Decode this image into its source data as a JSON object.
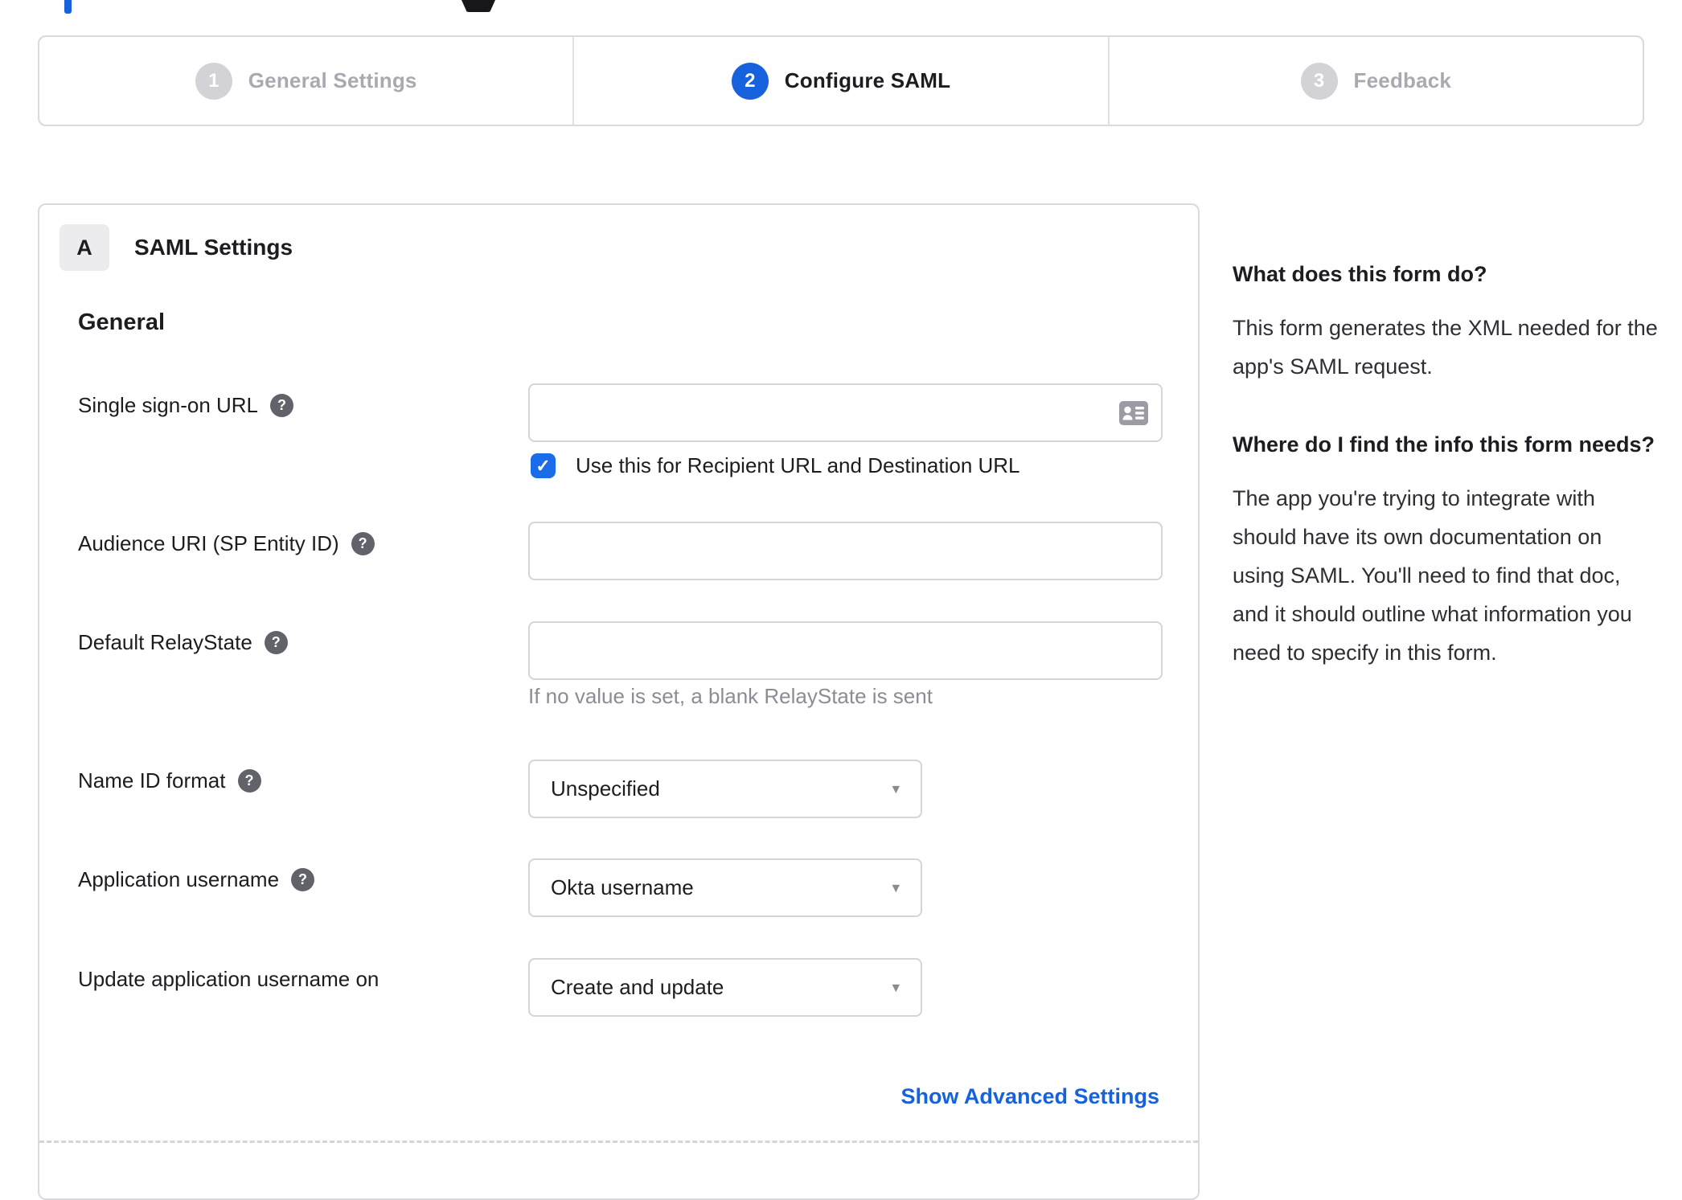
{
  "stepper": {
    "steps": [
      {
        "number": "1",
        "label": "General Settings",
        "state": "inactive"
      },
      {
        "number": "2",
        "label": "Configure SAML",
        "state": "active"
      },
      {
        "number": "3",
        "label": "Feedback",
        "state": "inactive"
      }
    ]
  },
  "panel": {
    "section_badge": "A",
    "section_title": "SAML Settings",
    "group_title": "General",
    "fields": {
      "sso_url": {
        "label": "Single sign-on URL",
        "value": ""
      },
      "sso_checkbox": {
        "label": "Use this for Recipient URL and Destination URL",
        "checked": true
      },
      "audience_uri": {
        "label": "Audience URI (SP Entity ID)",
        "value": ""
      },
      "default_relaystate": {
        "label": "Default RelayState",
        "value": "",
        "hint": "If no value is set, a blank RelayState is sent"
      },
      "name_id_format": {
        "label": "Name ID format",
        "value": "Unspecified"
      },
      "app_username": {
        "label": "Application username",
        "value": "Okta username"
      },
      "update_app_username": {
        "label": "Update application username on",
        "value": "Create and update"
      }
    },
    "advanced_link": "Show Advanced Settings"
  },
  "sidebar": {
    "sections": [
      {
        "heading": "What does this form do?",
        "body": "This form generates the XML needed for the app's SAML request."
      },
      {
        "heading": "Where do I find the info this form needs?",
        "body": "The app you're trying to integrate with should have its own documentation on using SAML. You'll need to find that doc, and it should outline what information you need to specify in this form."
      }
    ]
  },
  "icons": {
    "help": "?",
    "checkbox_check": "✓",
    "dropdown_caret": "▾"
  },
  "colors": {
    "accent_blue": "#1662dd",
    "checkbox_blue": "#1b6ce8",
    "border_gray": "#d9d9de",
    "inactive_gray": "#a9a9b2",
    "text_dark": "#1d1d21",
    "muted_gray": "#8c8c96"
  }
}
